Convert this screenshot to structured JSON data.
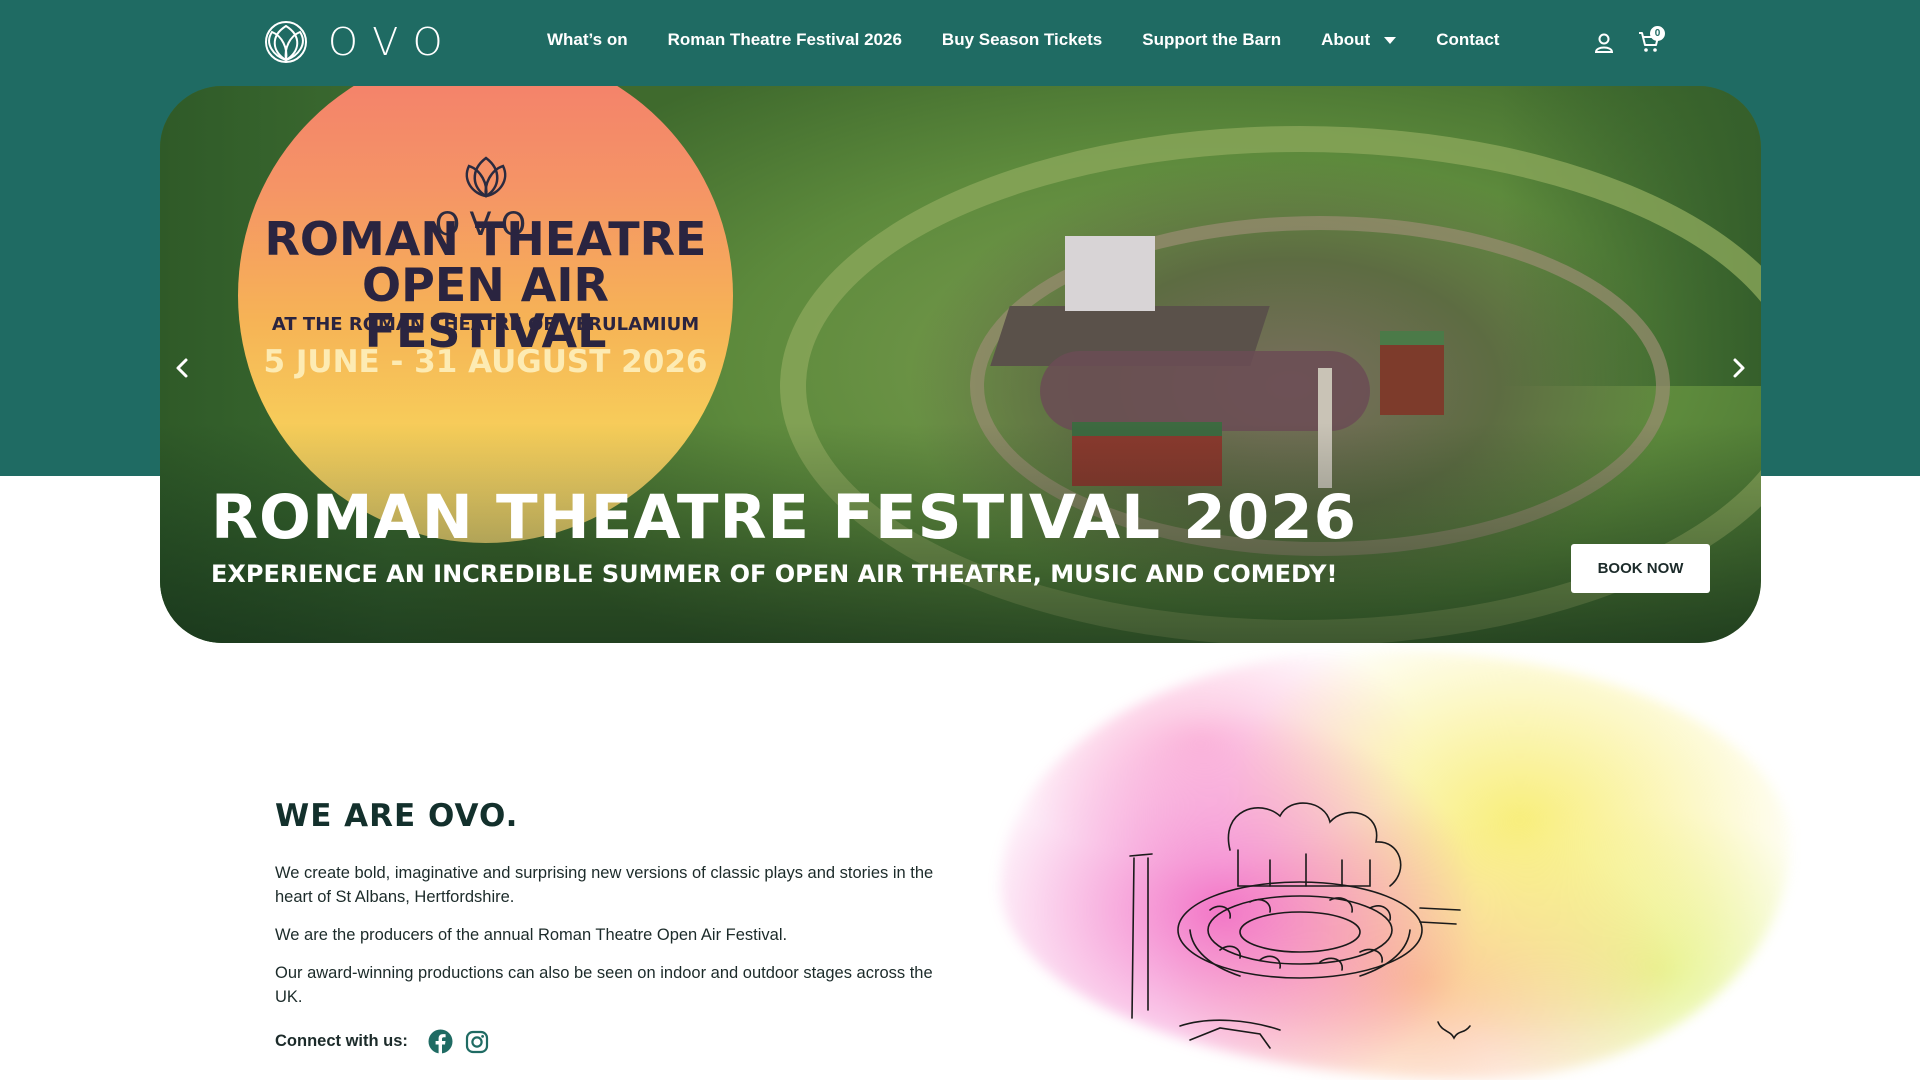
{
  "header": {
    "logo_text": "OVO",
    "nav": [
      {
        "label": "What’s on"
      },
      {
        "label": "Roman Theatre Festival 2026"
      },
      {
        "label": "Buy Season Tickets"
      },
      {
        "label": "Support the Barn"
      },
      {
        "label": "About",
        "has_dropdown": true
      },
      {
        "label": "Contact"
      }
    ],
    "icons": [
      "account-icon",
      "cart-icon"
    ],
    "cart_count": "0"
  },
  "hero": {
    "poster": {
      "logo_text": "OVO",
      "title_line1": "ROMAN THEATRE",
      "title_line2": "OPEN AIR FESTIVAL",
      "venue": "AT THE ROMAN THEATRE OF VERULAMIUM",
      "dates": "5 JUNE - 31 AUGUST 2026"
    },
    "title": "ROMAN THEATRE FESTIVAL 2026",
    "subtitle": "EXPERIENCE AN INCREDIBLE SUMMER OF OPEN AIR THEATRE, MUSIC AND COMEDY!",
    "cta_label": "BOOK NOW",
    "icons": [
      "chevron-left-icon",
      "chevron-right-icon"
    ]
  },
  "about": {
    "heading": "WE ARE OVO.",
    "paragraphs": [
      "We create bold, imaginative and surprising new versions of classic plays and stories in the heart of St Albans, Hertfordshire.",
      "We are the producers of the annual Roman Theatre Open Air Festival.",
      "Our award-winning productions can also be seen on indoor and outdoor stages across the UK."
    ],
    "connect_label": "Connect with us:",
    "social_icons": [
      "facebook-icon",
      "instagram-icon"
    ]
  },
  "colors": {
    "brand_teal": "#1f6b63",
    "heading_dark": "#13302c",
    "white": "#ffffff"
  }
}
